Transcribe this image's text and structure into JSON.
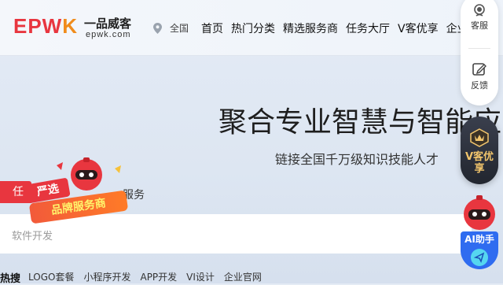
{
  "brand": {
    "name": "EPWK",
    "cn_name": "一品威客",
    "url": "epwk.com"
  },
  "location": {
    "label": "全国"
  },
  "nav": {
    "items": [
      "首页",
      "热门分类",
      "精选服务商",
      "任务大厅",
      "V客优享",
      "企业服务"
    ]
  },
  "sidebar": {
    "kefu": "客服",
    "feedback": "反馈",
    "vip": "V客优享",
    "ai": "AI助手"
  },
  "hero": {
    "headline": "聚合专业智慧与智能应",
    "subline": "链接全国千万级知识技能人才"
  },
  "search_tabs": {
    "task": "任",
    "service": "服务"
  },
  "search": {
    "placeholder": "软件开发"
  },
  "promo": {
    "tag1": "严选",
    "tag2": "品牌服务商"
  },
  "hot_search": {
    "label": "热搜",
    "items": [
      "LOGO套餐",
      "小程序开发",
      "APP开发",
      "VI设计",
      "企业官网"
    ]
  },
  "colors": {
    "brand_red": "#e8363f",
    "brand_orange": "#f08c1c",
    "ai_blue": "#2f6cf0",
    "vip_gold": "#f2c56c"
  }
}
